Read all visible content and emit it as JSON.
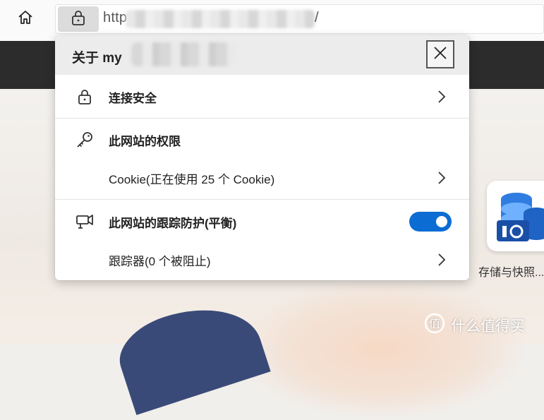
{
  "browser": {
    "url_prefix": "http",
    "url_suffix": "/"
  },
  "popup": {
    "title": "关于 my",
    "rows": {
      "connection": "连接安全",
      "permissions": "此网站的权限",
      "cookies": "Cookie(正在使用 25 个 Cookie)",
      "tracking": "此网站的跟踪防护(平衡)",
      "trackers": "跟踪器(0 个被阻止)"
    },
    "tracking_enabled": true
  },
  "page": {
    "app_label": "存储与快照..."
  },
  "watermark": {
    "text": "什么值得买"
  },
  "colors": {
    "toggle_on": "#0b6cd4",
    "header_band": "#2c2c2c"
  }
}
